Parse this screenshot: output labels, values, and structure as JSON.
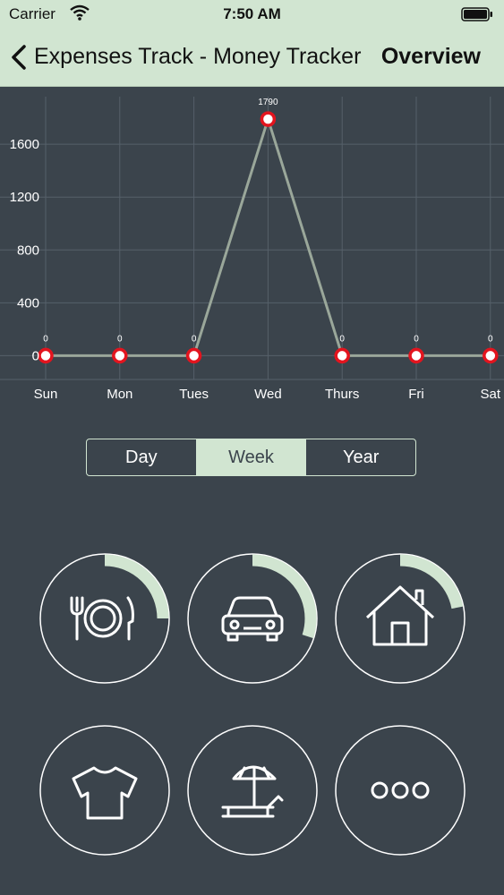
{
  "status_bar": {
    "carrier": "Carrier",
    "time": "7:50 AM"
  },
  "nav": {
    "back_label": "Expenses Track - Money Tracker",
    "title": "Overview"
  },
  "chart_data": {
    "type": "line",
    "categories": [
      "Sun",
      "Mon",
      "Tues",
      "Wed",
      "Thurs",
      "Fri",
      "Sat"
    ],
    "values": [
      0,
      0,
      0,
      1790,
      0,
      0,
      0
    ],
    "yticks": [
      0,
      400,
      800,
      1200,
      1600
    ],
    "ylim": [
      -180,
      1960
    ],
    "grid": true,
    "line_color": "#9aa79a",
    "marker_color": "#e3141e"
  },
  "segment": {
    "options": [
      "Day",
      "Week",
      "Year"
    ],
    "selected": "Week"
  },
  "categories": [
    {
      "icon": "dining-icon",
      "progress": 0.25
    },
    {
      "icon": "car-icon",
      "progress": 0.3
    },
    {
      "icon": "house-icon",
      "progress": 0.22
    },
    {
      "icon": "tshirt-icon",
      "progress": 0
    },
    {
      "icon": "beach-chair-icon",
      "progress": 0
    },
    {
      "icon": "more-icon",
      "progress": 0
    }
  ],
  "colors": {
    "background": "#3b444c",
    "accent": "#d1e5d1",
    "grid": "#56606a"
  }
}
